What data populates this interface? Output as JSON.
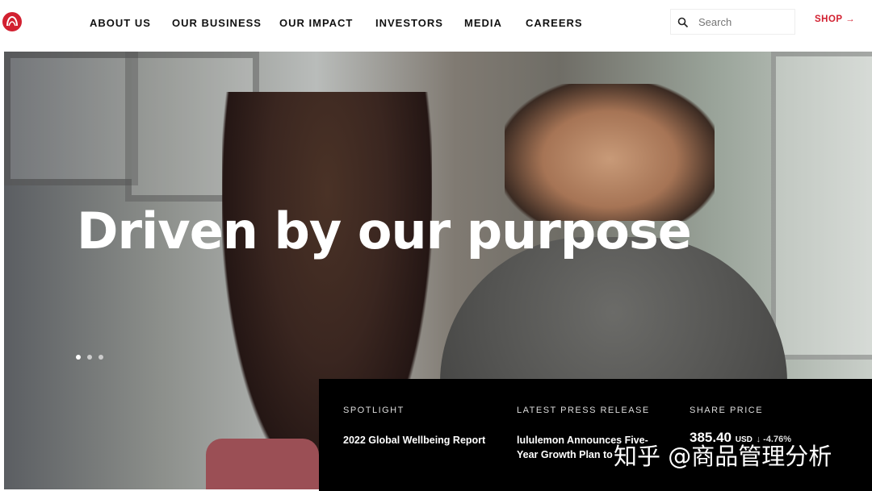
{
  "header": {
    "nav": [
      "ABOUT US",
      "OUR BUSINESS",
      "OUR IMPACT",
      "INVESTORS",
      "MEDIA",
      "CAREERS"
    ],
    "search_placeholder": "Search",
    "shop_label": "SHOP →"
  },
  "hero": {
    "headline": "Driven by our purpose",
    "carousel_active_index": 0,
    "carousel_count": 3
  },
  "info_bar": {
    "spotlight_label": "SPOTLIGHT",
    "spotlight_value": "2022 Global Wellbeing Report",
    "press_label": "LATEST PRESS RELEASE",
    "press_line1": "lululemon Announces Five-",
    "press_line2": "Year Growth Plan to",
    "share_label": "SHARE PRICE",
    "share_price": "385.40",
    "share_currency": "USD",
    "share_change": "↓ -4.76%"
  },
  "watermark": "知乎 @商品管理分析",
  "colors": {
    "brand_red": "#d22030",
    "info_bg": "#000000"
  }
}
